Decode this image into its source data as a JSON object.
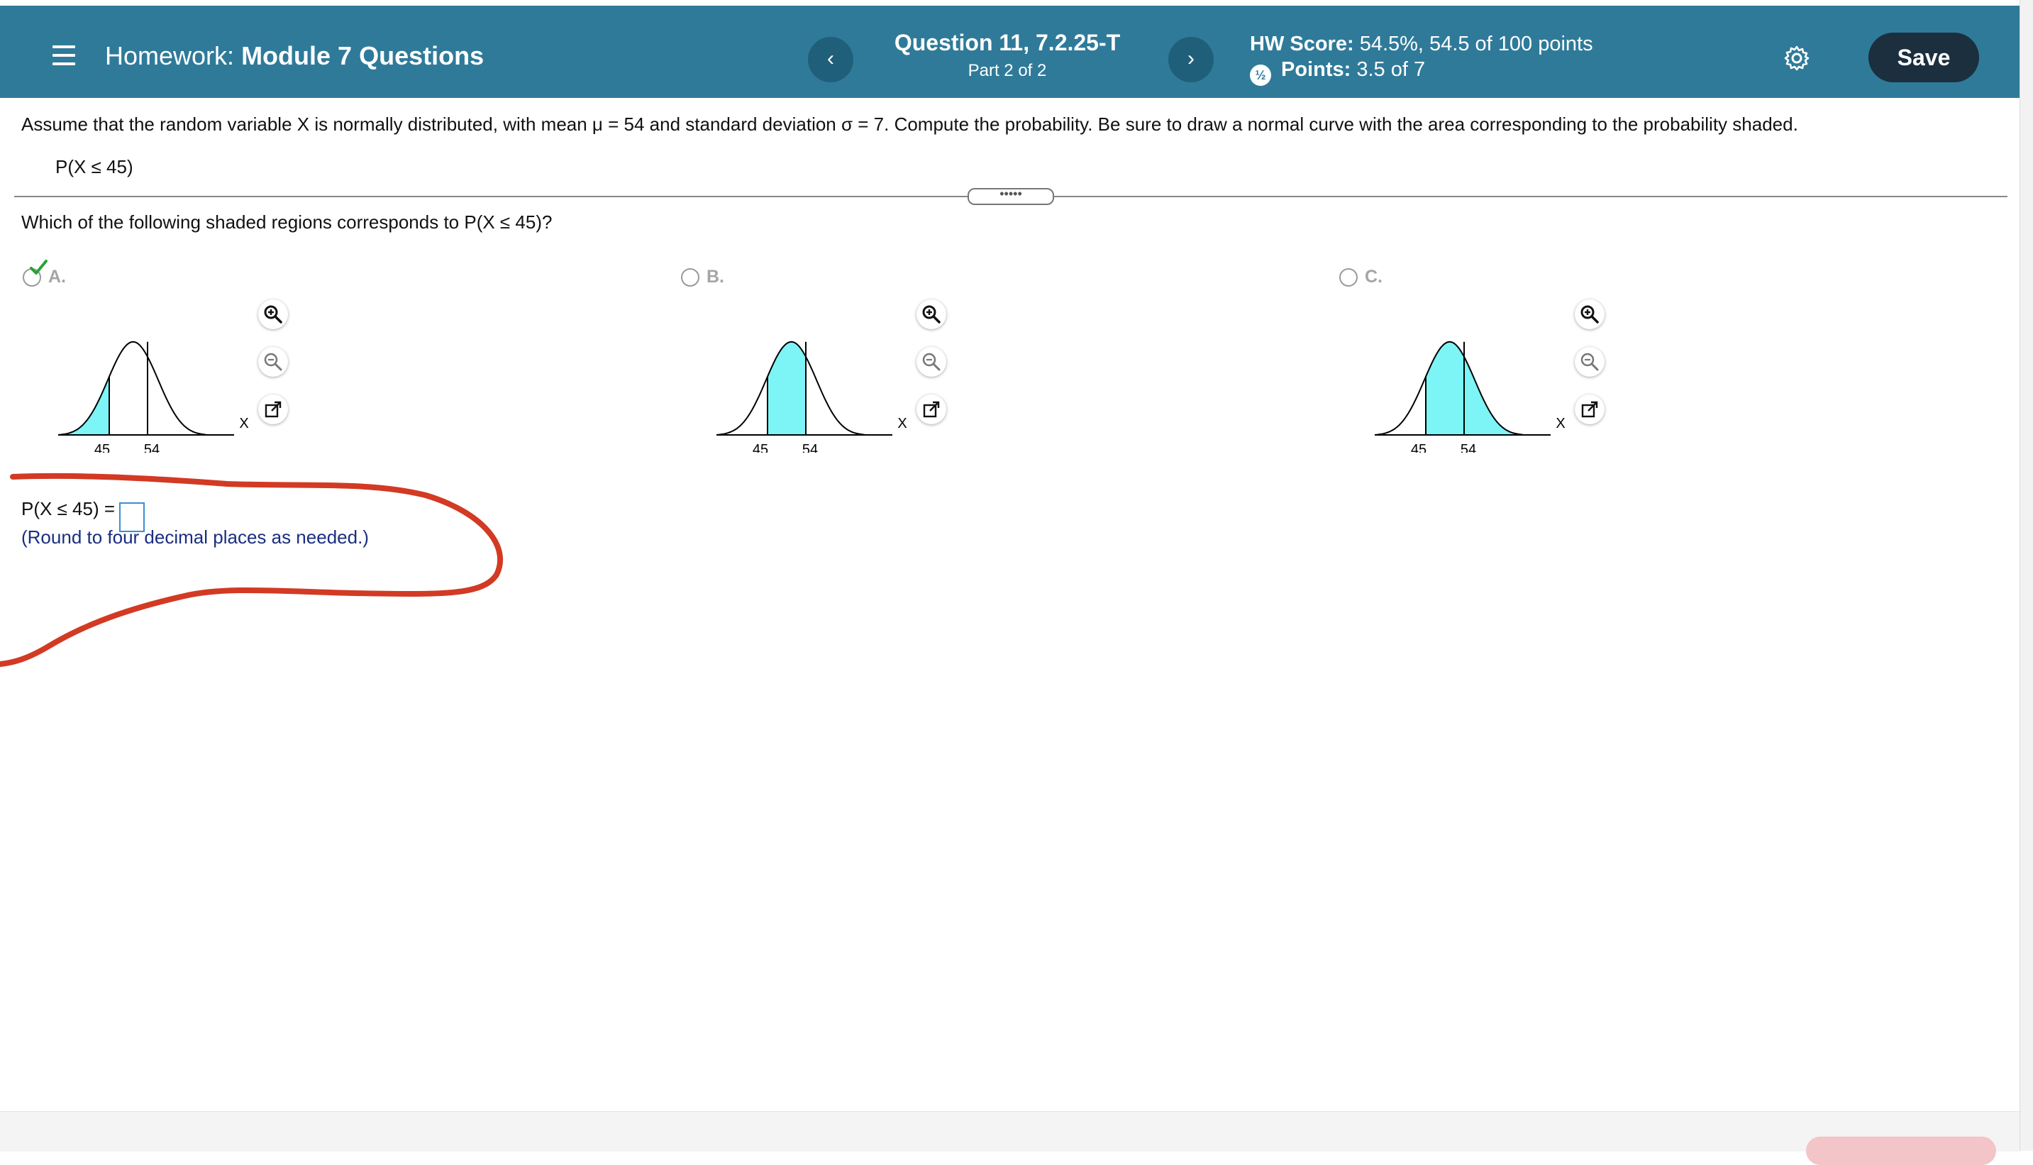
{
  "header": {
    "title_prefix": "Homework:",
    "title": "Module 7 Questions",
    "prev_symbol": "‹",
    "next_symbol": "›",
    "question_title": "Question 11, 7.2.25-T",
    "question_part": "Part 2 of 2",
    "hw_score_label": "HW Score:",
    "hw_score_value": "54.5%, 54.5 of 100 points",
    "points_label": "Points:",
    "points_value": "3.5 of 7",
    "save_label": "Save",
    "colors": {
      "bar": "#2f7a99",
      "save_button": "#1b2f3f",
      "nav_button": "#1f5f7a"
    }
  },
  "question": {
    "prompt": "Assume that the random variable X is normally distributed, with mean μ = 54 and standard deviation σ = 7. Compute the probability. Be sure to draw a normal curve with the area corresponding to the probability shaded.",
    "target": "P(X ≤ 45)",
    "expander_label": "•••••",
    "sub_question": "Which of the following shaded regions corresponds to P(X ≤ 45)?"
  },
  "options": [
    {
      "label": "A.",
      "selected": true,
      "correct": true,
      "shading": "left of 45",
      "tick_labels": [
        "45",
        "54"
      ],
      "axis_label": "X"
    },
    {
      "label": "B.",
      "selected": false,
      "shading": "between 45 and 54",
      "tick_labels": [
        "45",
        "54"
      ],
      "axis_label": "X"
    },
    {
      "label": "C.",
      "selected": false,
      "shading": "right of 45",
      "tick_labels": [
        "45",
        "54"
      ],
      "axis_label": "X"
    }
  ],
  "plot_tools": [
    "zoom-in-icon",
    "zoom-out-icon",
    "open-external-icon"
  ],
  "answer": {
    "label": "P(X ≤ 45) =",
    "value": "",
    "note": "(Round to four decimal places as needed.)"
  },
  "colors": {
    "shade": "#7df4f6",
    "check": "#2aa13a",
    "annotation": "#d23a24",
    "note_text": "#1a2e80"
  }
}
